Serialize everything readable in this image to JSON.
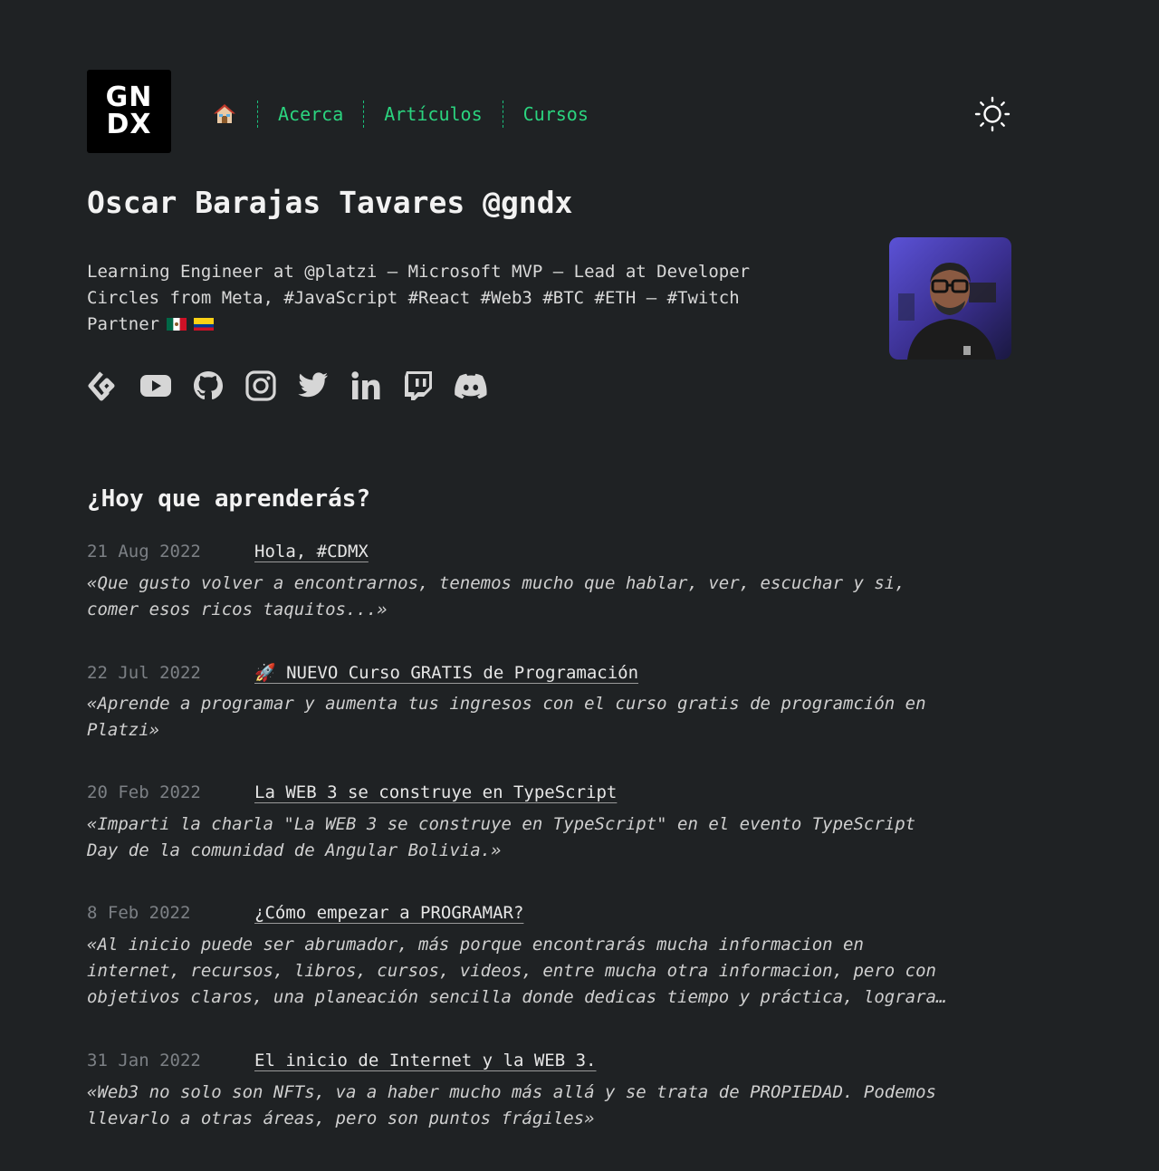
{
  "header": {
    "logo": {
      "line1": "GN",
      "line2": "DX"
    },
    "nav": [
      {
        "label": "Acerca"
      },
      {
        "label": "Artículos"
      },
      {
        "label": "Cursos"
      }
    ]
  },
  "profile": {
    "name": "Oscar Barajas Tavares @gndx",
    "bio": "Learning Engineer at @platzi – Microsoft MVP – Lead at Developer Circles from Meta, #JavaScript #React #Web3 #BTC #ETH – #Twitch Partner"
  },
  "socials": [
    "platzi-icon",
    "youtube-icon",
    "github-icon",
    "instagram-icon",
    "twitter-icon",
    "linkedin-icon",
    "twitch-icon",
    "discord-icon"
  ],
  "section": {
    "title": "¿Hoy que aprenderás?"
  },
  "posts": [
    {
      "date": "21 Aug 2022",
      "title": "Hola, #CDMX",
      "desc": "«Que gusto volver a encontrarnos, tenemos mucho que hablar, ver, escuchar y si,\ncomer esos ricos taquitos...»"
    },
    {
      "date": "22 Jul 2022",
      "title": "🚀 NUEVO Curso GRATIS de Programación",
      "desc": "«Aprende a programar y aumenta tus ingresos con el curso gratis de programción en\nPlatzi»"
    },
    {
      "date": "20 Feb 2022",
      "title": "La WEB 3 se construye en TypeScript",
      "desc": "«Imparti la charla \"La WEB 3 se construye en TypeScript\" en el evento TypeScript\nDay de la comunidad de Angular Bolivia.»"
    },
    {
      "date": "8 Feb 2022",
      "title": "¿Cómo empezar a PROGRAMAR?",
      "desc": "«Al inicio puede ser abrumador, más porque encontrarás mucha informacion en\ninternet, recursos, libros, cursos, videos, entre mucha otra informacion, pero con\nobjetivos claros, una planeación sencilla donde dedicas tiempo y práctica, lograra…"
    },
    {
      "date": "31 Jan 2022",
      "title": "El inicio de Internet y la WEB 3.",
      "desc": "«Web3 no solo son NFTs, va a haber mucho más allá y se trata de PROPIEDAD. Podemos\nllevarlo a otras áreas, pero son puntos frágiles»"
    }
  ],
  "colors": {
    "background": "#1f2224",
    "accent": "#2bd47f",
    "muted": "#7c8085"
  }
}
